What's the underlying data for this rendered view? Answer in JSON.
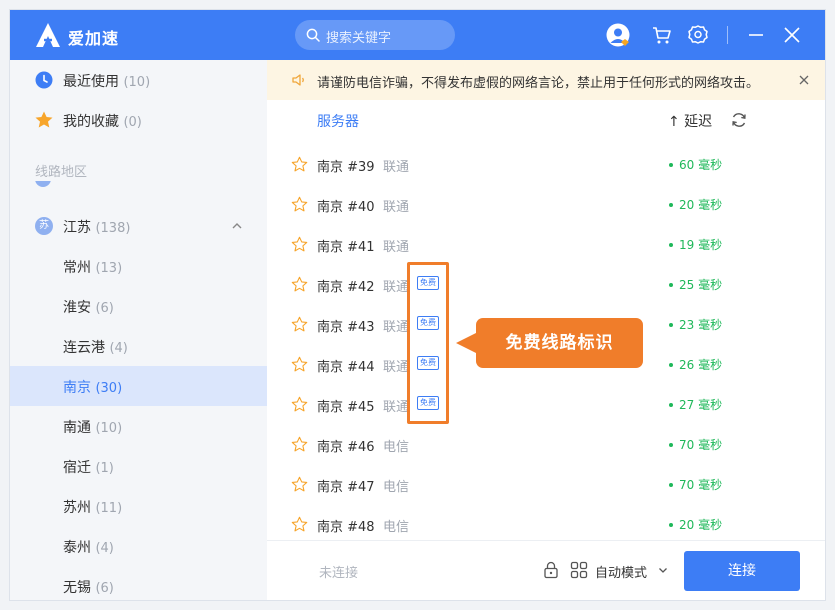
{
  "app": {
    "title": "爱加速",
    "logo_letter": "A"
  },
  "search": {
    "placeholder": "搜索关键字"
  },
  "sidebar": {
    "recent": {
      "label": "最近使用",
      "count": "(10)"
    },
    "favorites": {
      "label": "我的收藏",
      "count": "(0)"
    },
    "section_title": "线路地区",
    "province": {
      "label": "江苏",
      "count": "(138)",
      "icon_char": "苏"
    },
    "cities": [
      {
        "label": "常州",
        "count": "(13)"
      },
      {
        "label": "淮安",
        "count": "(6)"
      },
      {
        "label": "连云港",
        "count": "(4)"
      },
      {
        "label": "南京",
        "count": "(30)"
      },
      {
        "label": "南通",
        "count": "(10)"
      },
      {
        "label": "宿迁",
        "count": "(1)"
      },
      {
        "label": "苏州",
        "count": "(11)"
      },
      {
        "label": "泰州",
        "count": "(4)"
      },
      {
        "label": "无锡",
        "count": "(6)"
      }
    ]
  },
  "notice": {
    "text": "请谨防电信诈骗，不得发布虚假的网络言论，禁止用于任何形式的网络攻击。"
  },
  "list_header": {
    "server": "服务器",
    "delay": "↑ 延迟"
  },
  "servers": [
    {
      "name": "南京 #39",
      "isp": "联通",
      "badge": "",
      "latency": "60 毫秒"
    },
    {
      "name": "南京 #40",
      "isp": "联通",
      "badge": "",
      "latency": "20 毫秒"
    },
    {
      "name": "南京 #41",
      "isp": "联通",
      "badge": "",
      "latency": "19 毫秒"
    },
    {
      "name": "南京 #42",
      "isp": "联通",
      "badge": "免费",
      "latency": "25 毫秒"
    },
    {
      "name": "南京 #43",
      "isp": "联通",
      "badge": "免费",
      "latency": "23 毫秒"
    },
    {
      "name": "南京 #44",
      "isp": "联通",
      "badge": "免费",
      "latency": "26 毫秒"
    },
    {
      "name": "南京 #45",
      "isp": "联通",
      "badge": "免费",
      "latency": "27 毫秒"
    },
    {
      "name": "南京 #46",
      "isp": "电信",
      "badge": "",
      "latency": "70 毫秒"
    },
    {
      "name": "南京 #47",
      "isp": "电信",
      "badge": "",
      "latency": "70 毫秒"
    },
    {
      "name": "南京 #48",
      "isp": "电信",
      "badge": "",
      "latency": "20 毫秒"
    }
  ],
  "callout": {
    "text": "免费线路标识"
  },
  "footer": {
    "status": "未连接",
    "mode": "自动模式",
    "connect": "连接"
  },
  "colors": {
    "accent": "#3d7df5",
    "latency": "#1fb85a",
    "annotation": "#f07d2a",
    "notice_bg": "#fdf5e3"
  }
}
